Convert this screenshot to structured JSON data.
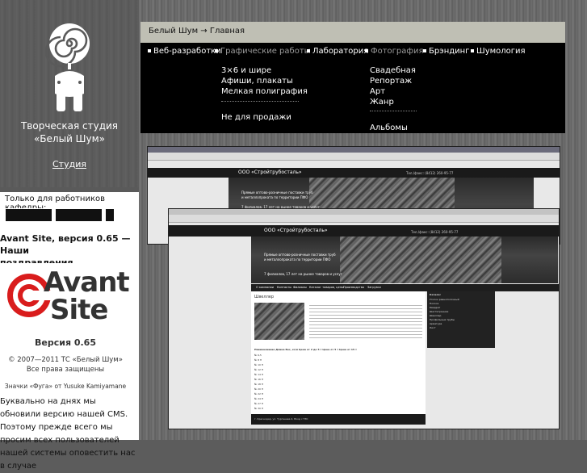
{
  "left": {
    "studio_line1": "Творческая студия",
    "studio_line2": "«Белый Шум»",
    "studio_link": "Студия",
    "staff_label": "Только для работников кафедры:"
  },
  "news": {
    "title_line1": "Avant Site, версия 0.65 — Наши",
    "title_line2": "поздравления пользователям!",
    "avant_word1": "Avant",
    "avant_word2": "Site",
    "avant_version": "Версия 0.65",
    "avant_copy1": "© 2007—2011 ТС «Белый Шум»",
    "avant_copy2": "Все права защищены",
    "avant_fuga": "Значки «Фуга» от Yusuke Kamiyamane",
    "text": "Буквально на днях мы обновили версию нашей CMS. Поэтому прежде всего мы просим всех пользователей нашей системы оповестить нас в случае"
  },
  "breadcrumb": "Белый Шум → Главная",
  "nav": [
    {
      "label": "Веб-разработки",
      "active": true
    },
    {
      "label": "Графические работы",
      "active": false
    },
    {
      "label": "Лаборатория",
      "active": true
    },
    {
      "label": "Фотография",
      "active": false
    },
    {
      "label": "Брэндинг",
      "active": true
    },
    {
      "label": "Шумология",
      "active": true
    }
  ],
  "dropdown_graphics": [
    "3×6 и шире",
    "Афиши, плакаты",
    "Мелкая полиграфия",
    "Не для продажи"
  ],
  "dropdown_photo": [
    "Свадебная",
    "Репортаж",
    "Арт",
    "Жанр",
    "Альбомы"
  ],
  "shot": {
    "site_name": "ООО «Стройтрубосталь»",
    "phone": "Тел./факс: (8412) 260-95-77",
    "banner_line1": "Прямые оптово-розничные поставки труб",
    "banner_line2": "и металлопроката по территории ПФО",
    "banner_line3": "7 филиалов, 17 лет на рынке товаров и услуг",
    "nav_items": [
      "О компании",
      "Контакты",
      "Филиалы",
      "Каталог товаров, цены",
      "Производство",
      "Загрузки"
    ],
    "content_title": "Швеллер",
    "sidebar_title": "Каталог",
    "sidebar_items": [
      "Уголок равнополочный",
      "Полоса",
      "Квадрат",
      "Шестигранник",
      "Швеллер",
      "Профильные трубы",
      "Арматура",
      "Лист"
    ],
    "table_header": "Наименование  Длина  Вес, кг/м  Цена от 2 до 5 т  Цена от 5 т  Цена от 15 т",
    "table_rows": [
      "№ 6,5",
      "№ 8 П",
      "№ 10 П",
      "№ 12 П",
      "№ 14 П",
      "№ 16 П",
      "№ 18 П",
      "№ 20 П",
      "№ 22 П",
      "№ 24 П",
      "№ 27 П",
      "№ 30 П"
    ],
    "footer": "г. Краснодар, ул. Тургенева 4, Вход с ТЭС"
  }
}
